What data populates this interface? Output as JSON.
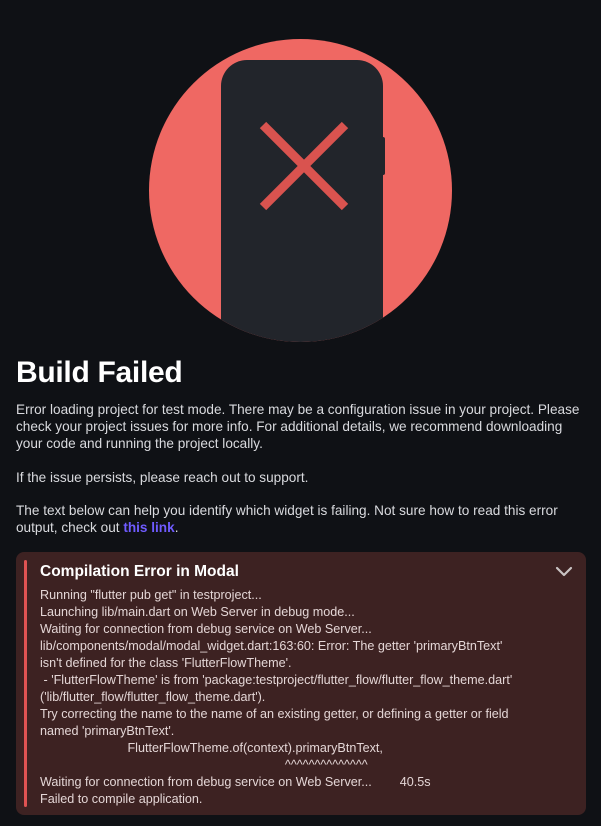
{
  "hero": {
    "circle_color": "#ef6863",
    "phone_color": "#22252b",
    "x_color": "#d9534f",
    "icon": "phone-error-icon"
  },
  "title": "Build Failed",
  "paragraphs": {
    "p1": "Error loading project for test mode. There may be a configuration issue in your project. Please check your project issues for more info. For additional details, we recommend downloading your code and running the project locally.",
    "p2": "If the issue persists, please reach out to support.",
    "p3_prefix": "The text below can help you identify which widget is failing. Not sure how to read this error output, check out ",
    "p3_link": "this link",
    "p3_suffix": "."
  },
  "error_panel": {
    "title": "Compilation Error in Modal",
    "accent_color": "#e05353",
    "background_color": "#3d2222",
    "chevron_icon": "chevron-down-icon",
    "log": "Running \"flutter pub get\" in testproject...\nLaunching lib/main.dart on Web Server in debug mode...\nWaiting for connection from debug service on Web Server...\nlib/components/modal/modal_widget.dart:163:60: Error: The getter 'primaryBtnText'\nisn't defined for the class 'FlutterFlowTheme'.\n - 'FlutterFlowTheme' is from 'package:testproject/flutter_flow/flutter_flow_theme.dart'\n('lib/flutter_flow/flutter_flow_theme.dart').\nTry correcting the name to the name of an existing getter, or defining a getter or field\nnamed 'primaryBtnText'.\n                         FlutterFlowTheme.of(context).primaryBtnText,\n                                                                      ^^^^^^^^^^^^^^\nWaiting for connection from debug service on Web Server...        40.5s\nFailed to compile application."
  }
}
